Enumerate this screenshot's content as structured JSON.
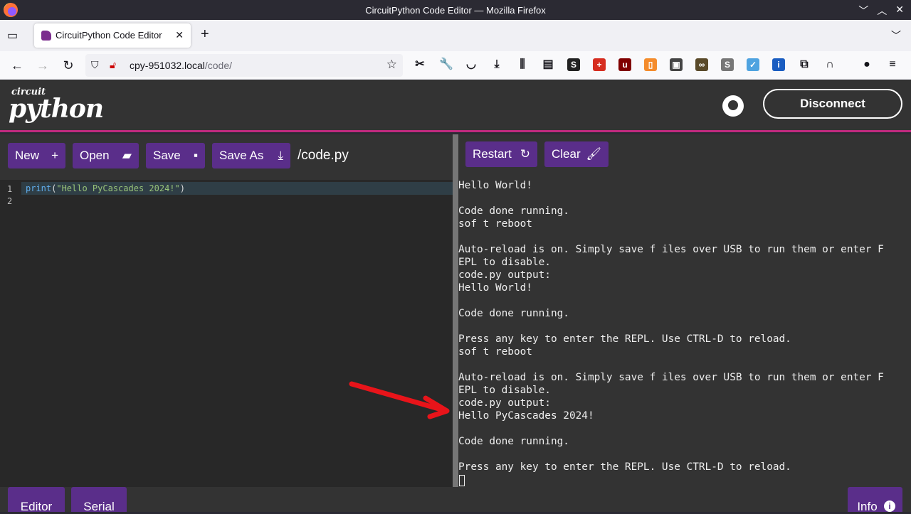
{
  "window": {
    "title": "CircuitPython Code Editor — Mozilla Firefox",
    "controls": [
      "﹀",
      "︿",
      "✕"
    ]
  },
  "browser": {
    "tab_title": "CircuitPython Code Editor",
    "url_host": "cpy-951032.local",
    "url_path": "/code/",
    "extensions": [
      {
        "name": "screenshot-ext-icon",
        "color": "#15141a",
        "glyph": "✂"
      },
      {
        "name": "wrench-icon",
        "color": "#15141a",
        "glyph": "🔧"
      },
      {
        "name": "pocket-icon",
        "color": "#15141a",
        "glyph": "◡"
      },
      {
        "name": "download-icon",
        "color": "#15141a",
        "glyph": "⤓"
      },
      {
        "name": "library-icon",
        "color": "#15141a",
        "glyph": "⫼"
      },
      {
        "name": "sidebar-icon",
        "color": "#15141a",
        "glyph": "▤"
      },
      {
        "name": "s-ext-icon",
        "color": "#222",
        "glyph": "S"
      },
      {
        "name": "plus-ext-icon",
        "color": "#d62d20",
        "glyph": "+"
      },
      {
        "name": "ublock-icon",
        "color": "#800000",
        "glyph": "u"
      },
      {
        "name": "trash-ext-icon",
        "color": "#f48c2c",
        "glyph": "▯"
      },
      {
        "name": "wallet-ext-icon",
        "color": "#444",
        "glyph": "▣"
      },
      {
        "name": "glasses-ext-icon",
        "color": "#5a4a2a",
        "glyph": "∞"
      },
      {
        "name": "stylus-ext-icon",
        "color": "#777",
        "glyph": "S"
      },
      {
        "name": "check-ext-icon",
        "color": "#4fa3e0",
        "glyph": "✓"
      },
      {
        "name": "password-ext-icon",
        "color": "#1a5dc1",
        "glyph": "i"
      },
      {
        "name": "puzzle-icon",
        "color": "#15141a",
        "glyph": "⧉"
      },
      {
        "name": "sync-ext-icon",
        "color": "#15141a",
        "glyph": "∩"
      },
      {
        "name": "profile-ext-icon",
        "color": "#15141a",
        "glyph": "●"
      },
      {
        "name": "menu-icon",
        "color": "#15141a",
        "glyph": "≡"
      }
    ]
  },
  "app": {
    "logo_small": "circuit",
    "logo_big": "python",
    "disconnect_label": "Disconnect",
    "toolbar": {
      "new": "New",
      "open": "Open",
      "save": "Save",
      "save_as": "Save As",
      "filename": "/code.py"
    },
    "serial_toolbar": {
      "restart": "Restart",
      "clear": "Clear"
    },
    "editor": {
      "lines": [
        "1",
        "2"
      ],
      "code_fn": "print",
      "code_open": "(",
      "code_str": "\"Hello PyCascades 2024!\"",
      "code_close": ")"
    },
    "serial_output": [
      "Hello World!",
      "",
      "Code done running.",
      "sof t reboot",
      "",
      "Auto-reload is on. Simply save f iles over USB to run them or enter F",
      "EPL to disable.",
      "code.py output:",
      "Hello World!",
      "",
      "Code done running.",
      "",
      "Press any key to enter the REPL. Use CTRL-D to reload.",
      "sof t reboot",
      "",
      "Auto-reload is on. Simply save f iles over USB to run them or enter F",
      "EPL to disable.",
      "code.py output:",
      "Hello PyCascades 2024!",
      "",
      "Code done running.",
      "",
      "Press any key to enter the REPL. Use CTRL-D to reload."
    ],
    "bottom_tabs": {
      "editor": "Editor",
      "serial": "Serial",
      "info": "Info"
    }
  },
  "colors": {
    "accent": "#5a2e8a",
    "header_border": "#c02a7e",
    "annotation_arrow": "#e8141a"
  }
}
